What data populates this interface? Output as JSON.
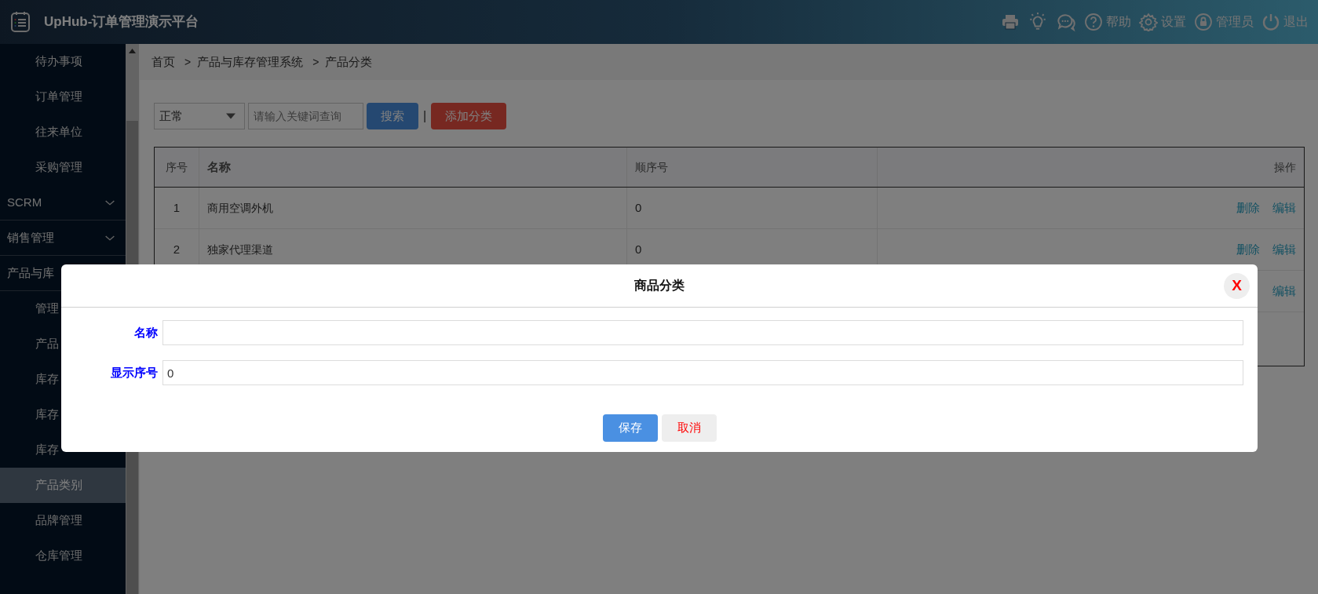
{
  "app": {
    "title": "UpHub-订单管理演示平台"
  },
  "header_actions": [
    {
      "label": "帮助"
    },
    {
      "label": "设置"
    },
    {
      "label": "管理员"
    },
    {
      "label": "退出"
    }
  ],
  "sidebar": {
    "items": [
      {
        "kind": "link",
        "label": "待办事项",
        "selected": false
      },
      {
        "kind": "link",
        "label": "订单管理",
        "selected": false
      },
      {
        "kind": "link",
        "label": "往来单位",
        "selected": false
      },
      {
        "kind": "link",
        "label": "采购管理",
        "selected": false
      },
      {
        "kind": "group",
        "label": "SCRM",
        "expanded": false
      },
      {
        "kind": "group",
        "label": "销售管理",
        "expanded": false
      },
      {
        "kind": "group",
        "label": "产品与库",
        "expanded": true,
        "children": [
          {
            "kind": "link",
            "label": "管理",
            "selected": false
          },
          {
            "kind": "link",
            "label": "产品",
            "selected": false
          },
          {
            "kind": "link",
            "label": "库存",
            "selected": false
          },
          {
            "kind": "link",
            "label": "库存",
            "selected": false
          },
          {
            "kind": "link",
            "label": "库存",
            "selected": false
          },
          {
            "kind": "link",
            "label": "产品类别",
            "selected": true
          },
          {
            "kind": "link",
            "label": "品牌管理",
            "selected": false
          },
          {
            "kind": "link",
            "label": "仓库管理",
            "selected": false
          }
        ]
      }
    ]
  },
  "breadcrumb": {
    "separator": ">",
    "items": [
      "首页",
      "产品与库存管理系统",
      "产品分类"
    ]
  },
  "toolbar": {
    "status_select": {
      "value": "正常"
    },
    "search": {
      "placeholder": "请输入关键词查询"
    },
    "separator": "|",
    "buttons": [
      {
        "kind": "primary",
        "label": "搜索"
      },
      {
        "kind": "danger",
        "label": "添加分类"
      }
    ]
  },
  "table": {
    "columns": [
      "序号",
      "名称",
      "顺序号",
      "操作"
    ],
    "rows": [
      {
        "cells": [
          "1",
          "商用空调外机",
          "0"
        ],
        "actions": [
          "删除",
          "编辑"
        ]
      },
      {
        "cells": [
          "2",
          "独家代理渠道",
          "0"
        ],
        "actions": [
          "删除",
          "编辑"
        ]
      },
      {
        "actions": [
          "编辑"
        ]
      }
    ]
  },
  "modal": {
    "title": "商品分类",
    "close": "X",
    "fields": [
      {
        "label": "名称"
      },
      {
        "label": "显示序号",
        "value": "0"
      }
    ],
    "buttons": [
      {
        "kind": "primary",
        "label": "保存"
      },
      {
        "kind": "cancel",
        "label": "取消"
      }
    ]
  }
}
